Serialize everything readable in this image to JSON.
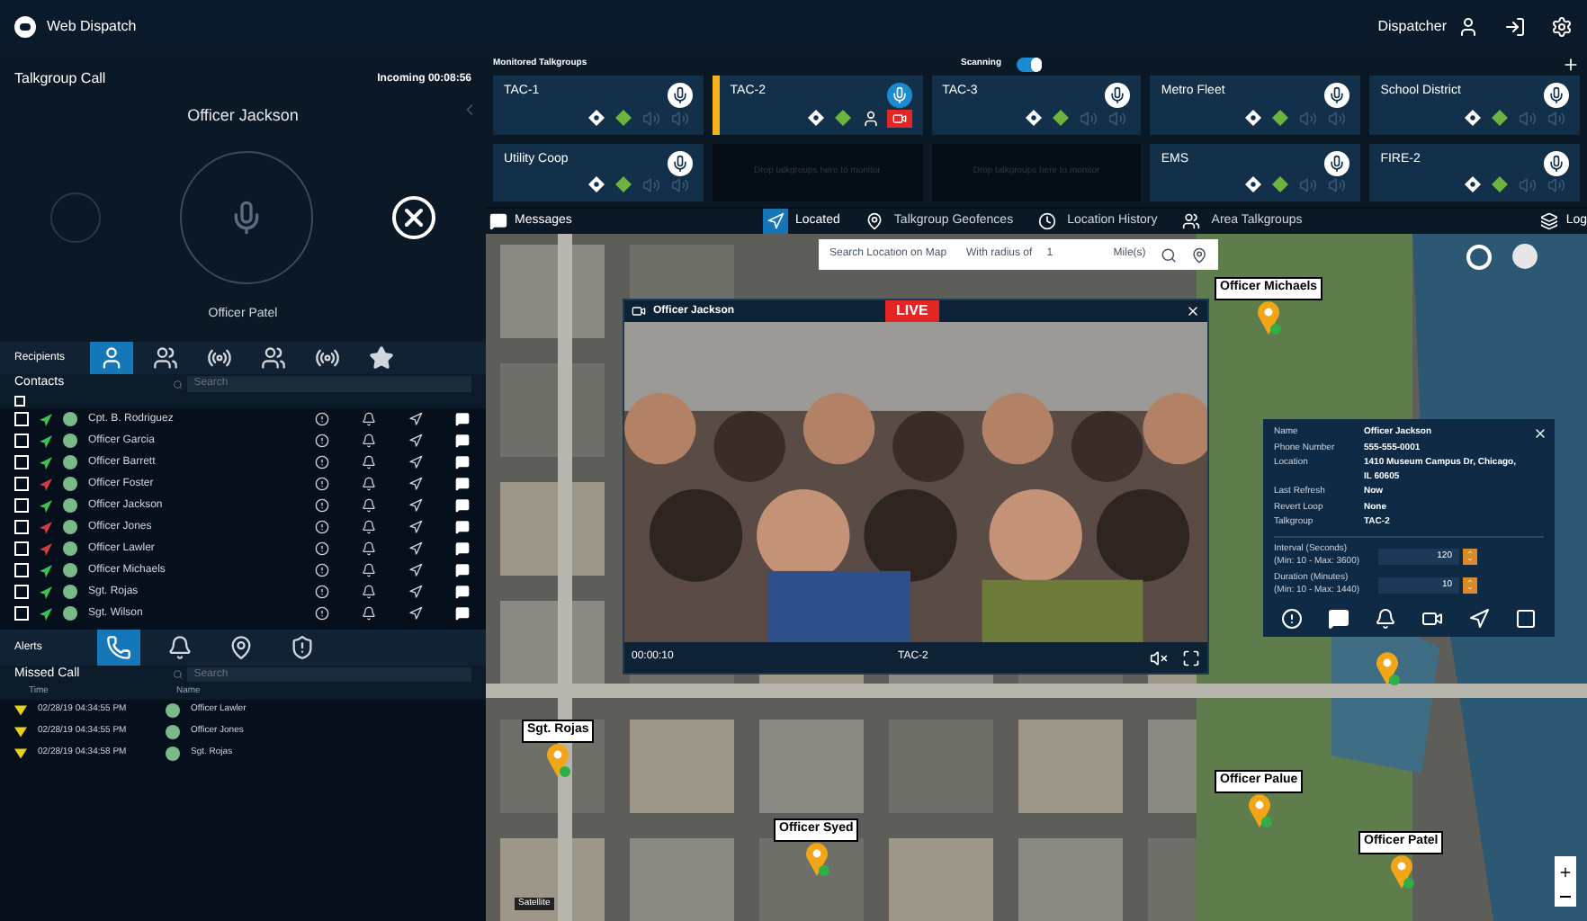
{
  "header": {
    "app_title": "Web Dispatch",
    "user": "Dispatcher"
  },
  "call": {
    "title": "Talkgroup Call",
    "status": "Incoming 00:08:56",
    "caller": "Officer Jackson",
    "speaker": "Officer Patel"
  },
  "recipients": {
    "label": "Recipients",
    "tabs": [
      {
        "kind": "user",
        "selected": true
      },
      {
        "kind": "group",
        "selected": false
      },
      {
        "kind": "radio",
        "selected": false
      },
      {
        "kind": "group",
        "selected": false
      },
      {
        "kind": "tower",
        "selected": false
      },
      {
        "kind": "star",
        "selected": false
      }
    ]
  },
  "contacts": {
    "title": "Contacts",
    "search_placeholder": "Search",
    "select_all_checked": false,
    "rows": [
      {
        "name": "Cpt. B. Rodriguez",
        "color": "#3fbf4f",
        "checked": false
      },
      {
        "name": "Officer Garcia",
        "color": "#3fbf4f",
        "checked": false
      },
      {
        "name": "Officer Barrett",
        "color": "#3fbf4f",
        "checked": false
      },
      {
        "name": "Officer Foster",
        "color": "#d23b3b",
        "checked": false
      },
      {
        "name": "Officer Jackson",
        "color": "#3fbf4f",
        "checked": false
      },
      {
        "name": "Officer Jones",
        "color": "#d23b3b",
        "checked": false
      },
      {
        "name": "Officer Lawler",
        "color": "#d23b3b",
        "checked": false
      },
      {
        "name": "Officer Michaels",
        "color": "#3fbf4f",
        "checked": false
      },
      {
        "name": "Sgt. Rojas",
        "color": "#3fbf4f",
        "checked": false
      },
      {
        "name": "Sgt. Wilson",
        "color": "#3fbf4f",
        "checked": false
      }
    ]
  },
  "alerts": {
    "label": "Alerts",
    "tabs": [
      {
        "kind": "missed",
        "selected": true
      },
      {
        "kind": "bell",
        "selected": false
      },
      {
        "kind": "pin",
        "selected": false
      },
      {
        "kind": "alarm",
        "selected": false
      }
    ]
  },
  "missed_calls": {
    "title": "Missed Call",
    "search_placeholder": "Search",
    "columns": [
      "Time",
      "Name"
    ],
    "rows": [
      {
        "time": "02/28/19 04:34:55 PM",
        "name": "Officer Lawler"
      },
      {
        "time": "02/28/19 04:34:55 PM",
        "name": "Officer Jones"
      },
      {
        "time": "02/28/19 04:34:58 PM",
        "name": "Sgt. Rojas"
      }
    ]
  },
  "talkgroups": {
    "title": "Monitored Talkgroups",
    "scanning_label": "Scanning",
    "scanning_on": true,
    "tiles": [
      {
        "kind": "talkgroup",
        "name": "TAC-1",
        "selected": false
      },
      {
        "kind": "talkgroup",
        "name": "TAC-2",
        "selected": true
      },
      {
        "kind": "talkgroup",
        "name": "TAC-3",
        "selected": false
      },
      {
        "kind": "talkgroup",
        "name": "Metro Fleet",
        "selected": false
      },
      {
        "kind": "talkgroup",
        "name": "School District",
        "selected": false
      },
      {
        "kind": "talkgroup",
        "name": "Utility Coop",
        "selected": false
      },
      {
        "kind": "empty",
        "hint": "Drop talkgroups here to monitor"
      },
      {
        "kind": "empty",
        "hint": "Drop talkgroups here to monitor"
      },
      {
        "kind": "talkgroup",
        "name": "EMS",
        "selected": false
      },
      {
        "kind": "talkgroup",
        "name": "FIRE-2",
        "selected": false
      }
    ]
  },
  "toolbar": {
    "messages": "Messages",
    "tabs": [
      {
        "label": "Located",
        "kind": "located",
        "selected": true
      },
      {
        "label": "Talkgroup Geofences",
        "kind": "geofence",
        "selected": false
      },
      {
        "label": "Location History",
        "kind": "history",
        "selected": false
      },
      {
        "label": "Area Talkgroups",
        "kind": "area",
        "selected": false
      }
    ],
    "logs": "Log"
  },
  "map": {
    "search_placeholder": "Search Location on Map",
    "radius_label": "With radius of",
    "radius_value": "1",
    "unit": "Mile(s)",
    "layer_label": "Satellite",
    "markers": [
      {
        "label": "Officer Michaels"
      },
      {
        "label": "Sgt. Rojas"
      },
      {
        "label": "Officer Syed"
      },
      {
        "label": "Officer Palue"
      },
      {
        "label": "Officer Patel"
      }
    ]
  },
  "video": {
    "title": "Officer Jackson",
    "badge": "LIVE",
    "time": "00:00:10",
    "talkgroup": "TAC-2"
  },
  "info": {
    "fields": [
      {
        "label": "Name",
        "value": "Officer Jackson"
      },
      {
        "label": "Phone Number",
        "value": "555-555-0001"
      },
      {
        "label": "Location",
        "value": "1410 Museum Campus Dr, Chicago, IL 60605"
      },
      {
        "label": "Last Refresh",
        "value": "Now"
      },
      {
        "label": "Revert Loop",
        "value": "None"
      },
      {
        "label": "Talkgroup",
        "value": "TAC-2"
      }
    ],
    "inputs": [
      {
        "label": "Interval (Seconds)",
        "hint": "(Min: 10 - Max: 3600)",
        "value": "120"
      },
      {
        "label": "Duration (Minutes)",
        "hint": "(Min: 10 - Max: 1440)",
        "value": "10"
      }
    ]
  }
}
